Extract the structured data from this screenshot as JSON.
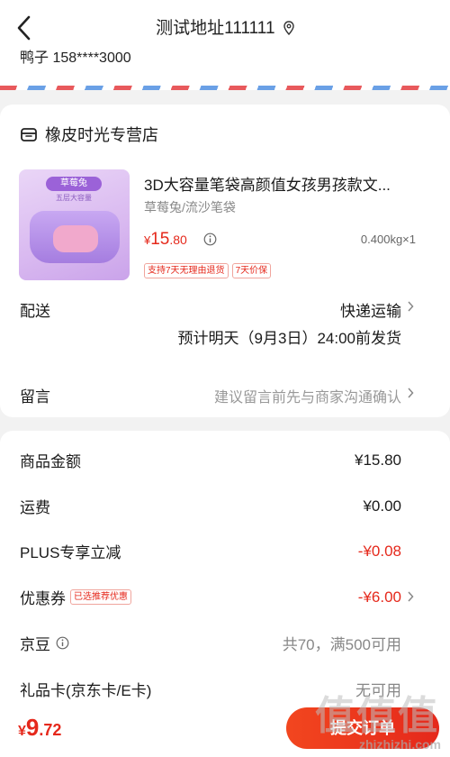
{
  "header": {
    "address": "测试地址111111",
    "contact": "鸭子 158****3000"
  },
  "shop": {
    "name": "橡皮时光专营店"
  },
  "product": {
    "image_tag": "草莓兔",
    "image_sub": "五层大容量",
    "name": "3D大容量笔袋高颜值女孩男孩款文...",
    "spec": "草莓兔/流沙笔袋",
    "price_currency": "¥",
    "price_int": "15",
    "price_dec": ".80",
    "weight_qty": "0.400kg×1",
    "badges": [
      "支持7天无理由退货",
      "7天价保"
    ]
  },
  "delivery": {
    "label": "配送",
    "method": "快递运输",
    "eta": "预计明天（9月3日）24:00前发货"
  },
  "message": {
    "label": "留言",
    "placeholder": "建议留言前先与商家沟通确认"
  },
  "summary": [
    {
      "label": "商品金额",
      "value": "¥15.80"
    },
    {
      "label": "运费",
      "value": "¥0.00"
    },
    {
      "label": "PLUS专享立减",
      "value": "-¥0.08"
    },
    {
      "label": "优惠券",
      "chip": "已选推荐优惠",
      "value": "-¥6.00"
    },
    {
      "label": "京豆",
      "value": "共70，满500可用"
    },
    {
      "label": "礼品卡(京东卡/E卡)",
      "value": "无可用"
    }
  ],
  "footer": {
    "total_currency": "¥",
    "total_int": "9",
    "total_dec": ".72",
    "submit_label": "提交订单"
  },
  "watermark": {
    "glyphs": "值值值",
    "url": "zhizhizhi.com"
  },
  "colors": {
    "accent": "#e5281b",
    "muted": "#888888"
  }
}
